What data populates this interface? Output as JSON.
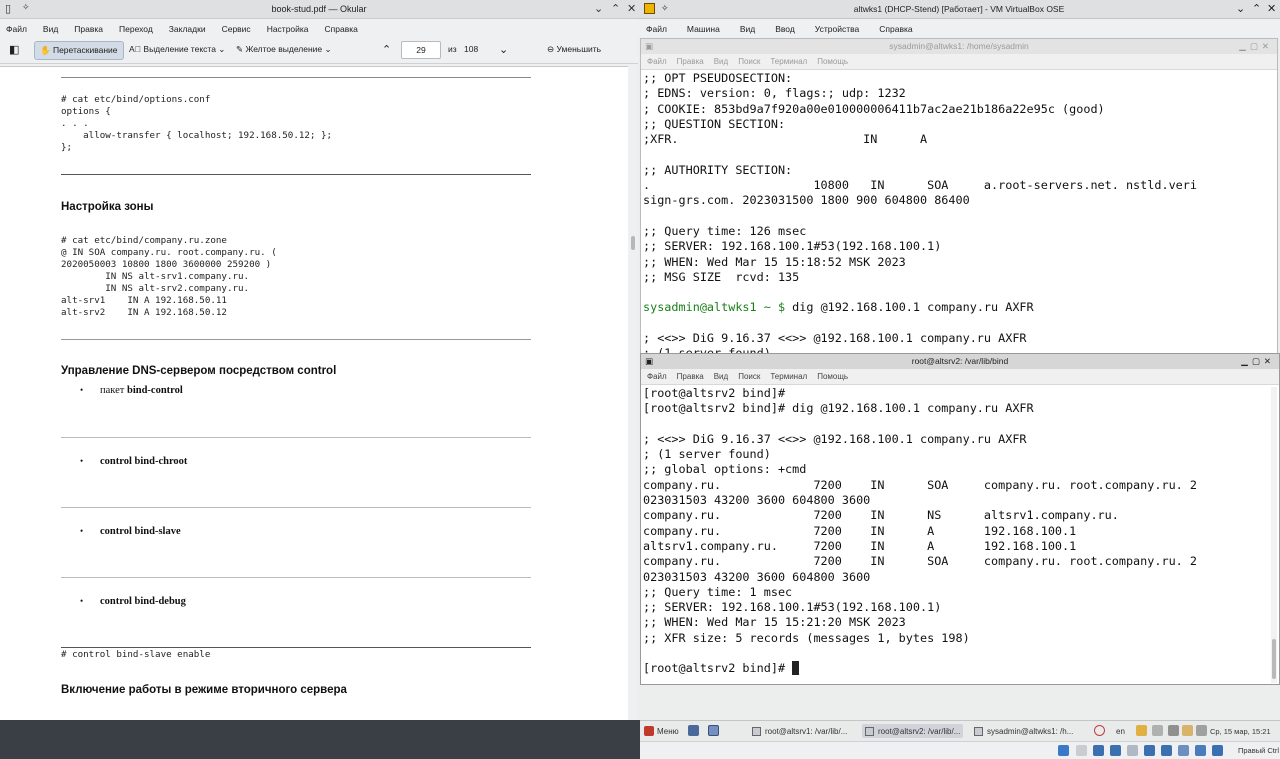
{
  "okular": {
    "title": "book-stud.pdf — Okular",
    "menu": [
      "Файл",
      "Вид",
      "Правка",
      "Переход",
      "Закладки",
      "Сервис",
      "Настройка",
      "Справка"
    ],
    "toolbar": {
      "drag_label": "Перетаскивание",
      "text_select_label": "Выделение текста",
      "highlight_label": "Желтое выделение",
      "page_value": "29",
      "page_of_label": "из",
      "page_total": "108",
      "zoom_out_label": "Уменьшить"
    },
    "doc": {
      "code1": "# cat etc/bind/options.conf\noptions {\n. . .\n    allow-transfer { localhost; 192.168.50.12; };\n};",
      "heading_zone": "Настройка зоны",
      "code2": "# cat etc/bind/company.ru.zone\n@ IN SOA company.ru. root.company.ru. (\n2020050003 10800 1800 3600000 259200 )\n        IN NS alt-srv1.company.ru.\n        IN NS alt-srv2.company.ru.\nalt-srv1    IN A 192.168.50.11\nalt-srv2    IN A 192.168.50.12",
      "heading_control": "Управление DNS-сервером посредством control",
      "bullet1_prefix": "пакет ",
      "bullet1_bold": "bind-control",
      "bullet2": "control bind-chroot",
      "bullet3": "control bind-slave",
      "bullet4": "control bind-debug",
      "code3": "# control bind-slave enable",
      "heading_secondary": "Включение работы в режиме вторичного сервера"
    }
  },
  "vbox": {
    "title": "altwks1 (DHCP-Stend) [Работает] - VM VirtualBox OSE",
    "menu": [
      "Файл",
      "Машина",
      "Вид",
      "Ввод",
      "Устройства",
      "Справка"
    ],
    "term1": {
      "title": "sysadmin@altwks1: /home/sysadmin",
      "menu": [
        "Файл",
        "Правка",
        "Вид",
        "Поиск",
        "Терминал",
        "Помощь"
      ],
      "content": ";; OPT PSEUDOSECTION:\n; EDNS: version: 0, flags:; udp: 1232\n; COOKIE: 853bd9a7f920a00e010000006411b7ac2ae21b186a22e95c (good)\n;; QUESTION SECTION:\n;XFR.                          IN      A\n\n;; AUTHORITY SECTION:\n.                       10800   IN      SOA     a.root-servers.net. nstld.veri\nsign-grs.com. 2023031500 1800 900 604800 86400\n\n;; Query time: 126 msec\n;; SERVER: 192.168.100.1#53(192.168.100.1)\n;; WHEN: Wed Mar 15 15:18:52 MSK 2023\n;; MSG SIZE  rcvd: 135\n\n",
      "prompt": "sysadmin@altwks1 ~ $ ",
      "command": "dig @192.168.100.1 company.ru AXFR",
      "tail": "\n\n; <<>> DiG 9.16.37 <<>> @192.168.100.1 company.ru AXFR\n; (1 server found)"
    },
    "term2": {
      "title": "root@altsrv2: /var/lib/bind",
      "menu": [
        "Файл",
        "Правка",
        "Вид",
        "Поиск",
        "Терминал",
        "Помощь"
      ],
      "content": "[root@altsrv2 bind]#\n[root@altsrv2 bind]# dig @192.168.100.1 company.ru AXFR\n\n; <<>> DiG 9.16.37 <<>> @192.168.100.1 company.ru AXFR\n; (1 server found)\n;; global options: +cmd\ncompany.ru.             7200    IN      SOA     company.ru. root.company.ru. 2\n023031503 43200 3600 604800 3600\ncompany.ru.             7200    IN      NS      altsrv1.company.ru.\ncompany.ru.             7200    IN      A       192.168.100.1\naltsrv1.company.ru.     7200    IN      A       192.168.100.1\ncompany.ru.             7200    IN      SOA     company.ru. root.company.ru. 2\n023031503 43200 3600 604800 3600\n;; Query time: 1 msec\n;; SERVER: 192.168.100.1#53(192.168.100.1)\n;; WHEN: Wed Mar 15 15:21:20 MSK 2023\n;; XFR size: 5 records (messages 1, bytes 198)\n\n[root@altsrv2 bind]# "
    },
    "taskbar": {
      "menu_label": "Меню",
      "tasks": [
        "root@altsrv1: /var/lib/...",
        "root@altsrv2: /var/lib/...",
        "sysadmin@altwks1: /h..."
      ],
      "lang": "en",
      "clock": "Ср, 15 мар, 15:21"
    },
    "host_ctrl": "Правый Ctrl"
  }
}
